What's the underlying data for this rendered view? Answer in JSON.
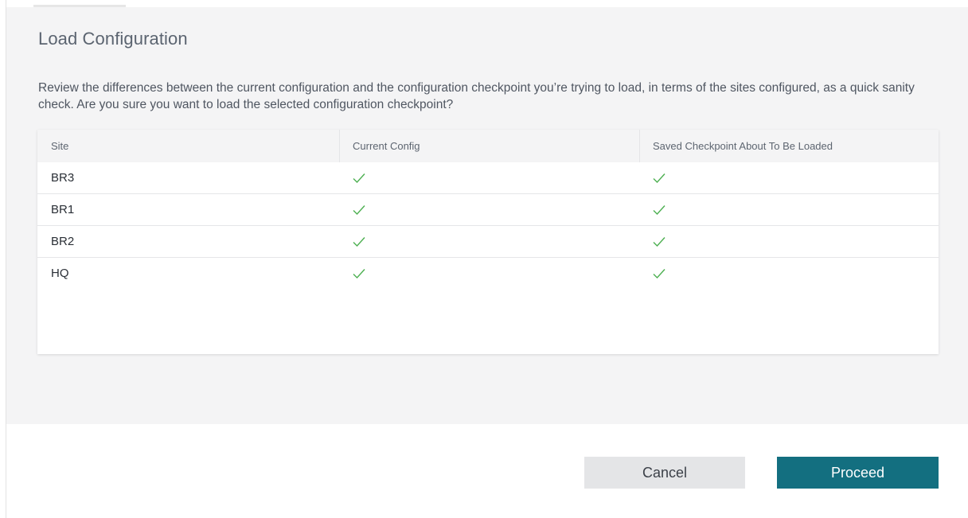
{
  "dialog": {
    "title": "Load Configuration",
    "description": "Review the differences between the current configuration and the configuration checkpoint you’re trying to load, in terms of the sites configured, as a quick sanity check. Are you sure you want to load the selected configuration checkpoint?"
  },
  "table": {
    "columns": [
      "Site",
      "Current Config",
      "Saved Checkpoint About To Be Loaded"
    ],
    "rows": [
      {
        "site": "BR3",
        "current": "check-icon",
        "saved": "check-icon"
      },
      {
        "site": "BR1",
        "current": "check-icon",
        "saved": "check-icon"
      },
      {
        "site": "BR2",
        "current": "check-icon",
        "saved": "check-icon"
      },
      {
        "site": "HQ",
        "current": "check-icon",
        "saved": "check-icon"
      }
    ]
  },
  "buttons": {
    "cancel_label": "Cancel",
    "proceed_label": "Proceed"
  },
  "colors": {
    "accent": "#136f80",
    "check": "#4caf50",
    "panel_bg": "#f4f4f5"
  }
}
